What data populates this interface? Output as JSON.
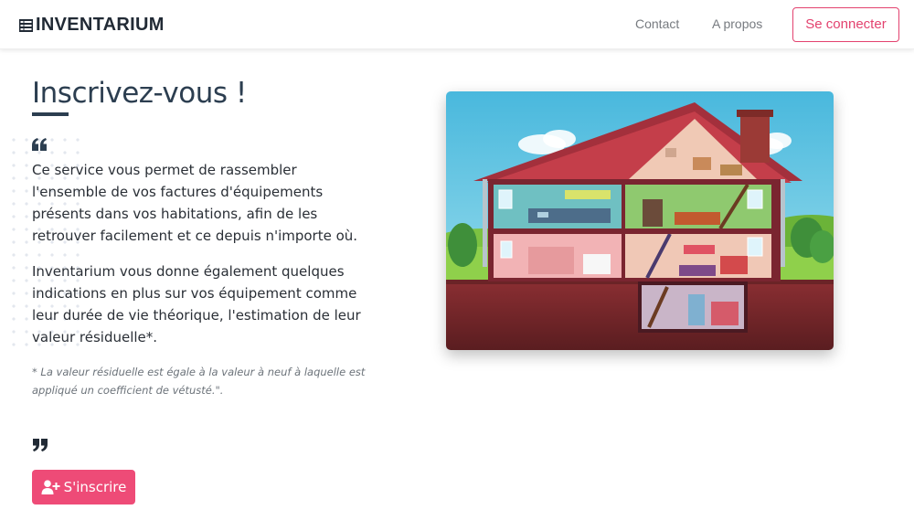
{
  "header": {
    "brand": "INVENTARIUM",
    "brand_icon": "list-icon",
    "nav": {
      "contact": "Contact",
      "about": "A propos",
      "login": "Se connecter"
    }
  },
  "main": {
    "title": "Inscrivez-vous !",
    "paragraphs": [
      "Ce service vous permet de rassembler l'ensemble de vos factures d'équipements présents dans vos habitations, afin de les retrouver facilement et ce depuis n'importe où.",
      "Inventarium vous donne également quelques indications en plus sur vos équipement comme leur durée de vie théorique, l'estimation de leur valeur résiduelle*."
    ],
    "note": "* La valeur résiduelle est égale à la valeur à neuf à laquelle est appliqué un coefficient de vétusté.\".",
    "signup_button": "S'inscrire",
    "signup_icon": "user-plus-icon"
  },
  "colors": {
    "accent": "#ee4b77",
    "outline": "#e3426f",
    "heading": "#2c3e50"
  }
}
